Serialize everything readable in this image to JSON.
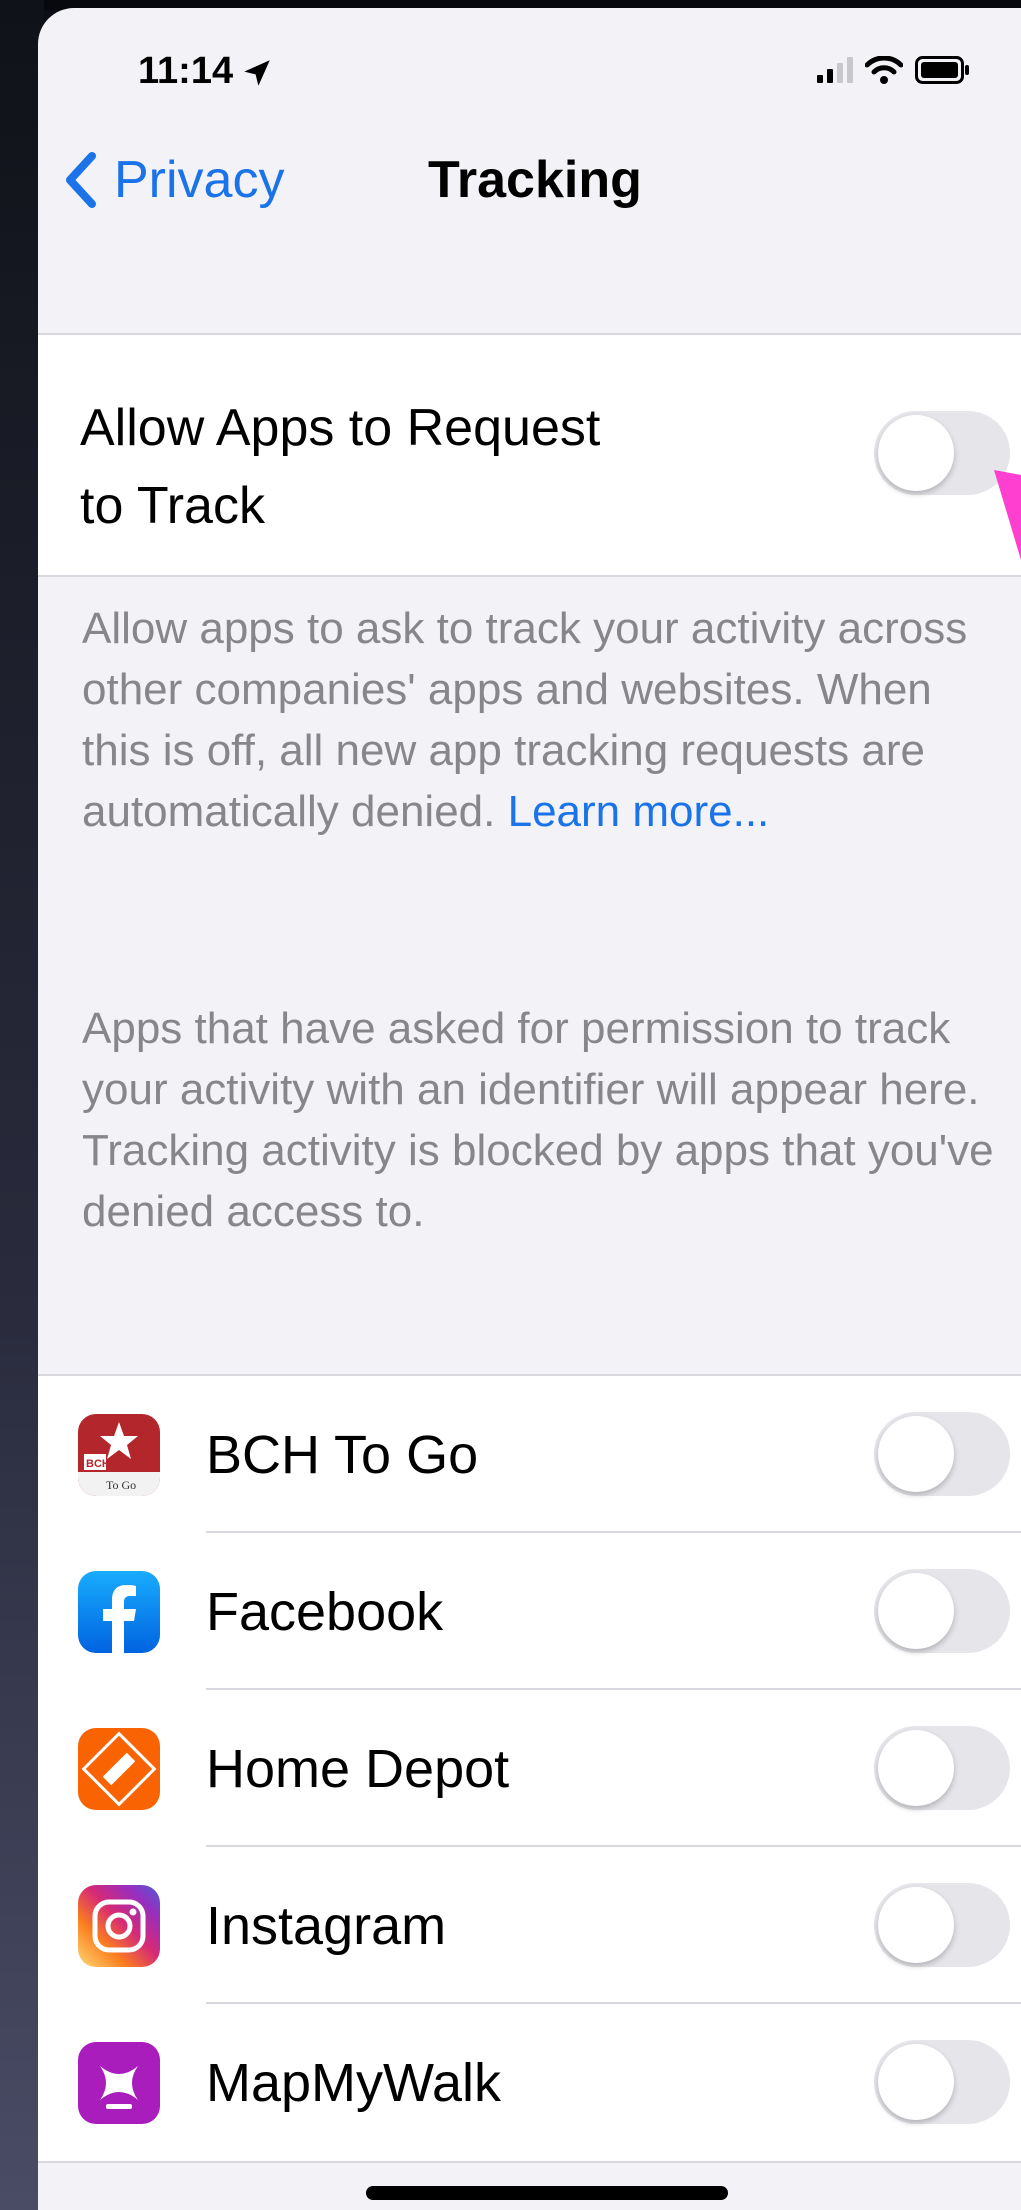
{
  "status_bar": {
    "time": "11:14"
  },
  "nav": {
    "back_label": "Privacy",
    "title": "Tracking"
  },
  "allow_setting": {
    "label": "Allow Apps to Request to Track",
    "enabled": false
  },
  "description": {
    "text": "Allow apps to ask to track your activity across other companies' apps and websites. When this is off, all new app tracking requests are automatically denied.",
    "link": "Learn more..."
  },
  "info_text": "Apps that have asked for permission to track your activity with an identifier will appear here. Tracking activity is blocked by apps that you've denied access to.",
  "apps": [
    {
      "name": "BCH To Go",
      "icon": "bch-to-go-app-icon",
      "enabled": false
    },
    {
      "name": "Facebook",
      "icon": "facebook-app-icon",
      "enabled": false
    },
    {
      "name": "Home Depot",
      "icon": "home-depot-app-icon",
      "enabled": false
    },
    {
      "name": "Instagram",
      "icon": "instagram-app-icon",
      "enabled": false
    },
    {
      "name": "MapMyWalk",
      "icon": "mapmywalk-app-icon",
      "enabled": false
    }
  ],
  "colors": {
    "accent": "#1a73e8",
    "background": "#f2f2f7",
    "toggle_off": "#e5e5ea",
    "annotation_arrow": "#ff3fcf"
  }
}
